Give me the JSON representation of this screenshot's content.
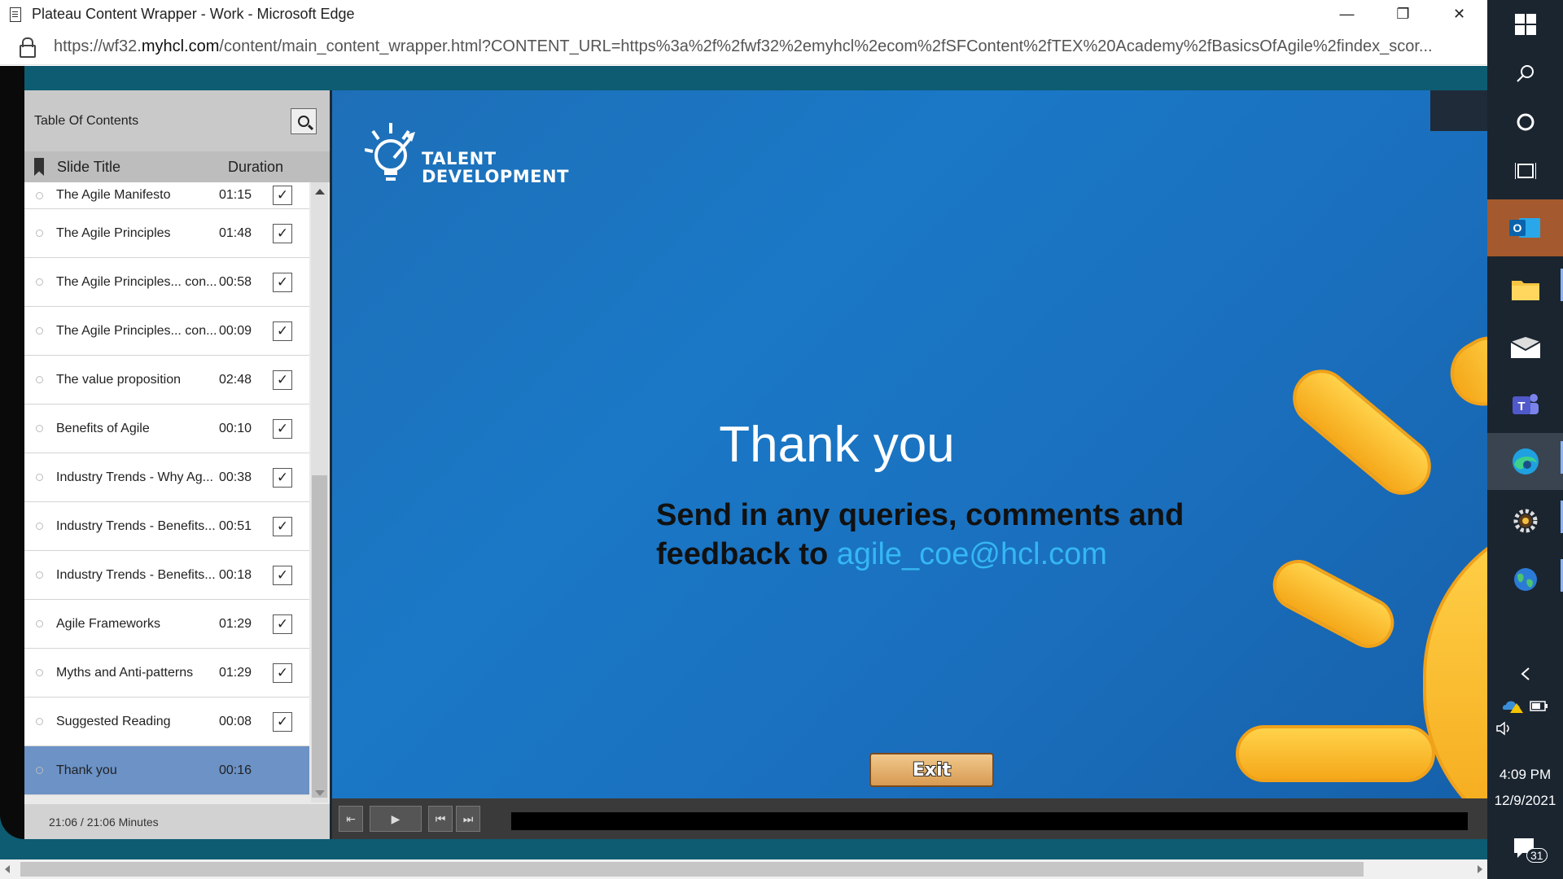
{
  "window": {
    "title": "Plateau Content Wrapper - Work - Microsoft Edge",
    "minimize": "—",
    "maximize": "❐",
    "close": "✕"
  },
  "address": {
    "url_domain_prefix": "https://wf32.",
    "url_domain": "myhcl.com",
    "url_rest": "/content/main_content_wrapper.html?CONTENT_URL=https%3a%2f%2fwf32%2emyhcl%2ecom%2fSFContent%2fTEX%20Academy%2fBasicsOfAgile%2findex_scor..."
  },
  "toc": {
    "title": "Table Of Contents",
    "col_title": "Slide Title",
    "col_duration": "Duration",
    "items": [
      {
        "title": "The Agile Manifesto",
        "duration": "01:15"
      },
      {
        "title": "The Agile Principles",
        "duration": "01:48"
      },
      {
        "title": "The Agile Principles... con...",
        "duration": "00:58"
      },
      {
        "title": "The Agile Principles... con...",
        "duration": "00:09"
      },
      {
        "title": "The value proposition",
        "duration": "02:48"
      },
      {
        "title": "Benefits of Agile",
        "duration": "00:10"
      },
      {
        "title": "Industry Trends - Why Ag...",
        "duration": "00:38"
      },
      {
        "title": "Industry Trends - Benefits...",
        "duration": "00:51"
      },
      {
        "title": "Industry Trends - Benefits...",
        "duration": "00:18"
      },
      {
        "title": "Agile Frameworks",
        "duration": "01:29"
      },
      {
        "title": "Myths and Anti-patterns",
        "duration": "01:29"
      },
      {
        "title": "Suggested Reading",
        "duration": "00:08"
      },
      {
        "title": "Thank you",
        "duration": "00:16"
      }
    ],
    "check_glyph": "✓",
    "footer": "21:06 / 21:06 Minutes"
  },
  "slide": {
    "logo_line1": "TALENT",
    "logo_line2": "DEVELOPMENT",
    "heading": "Thank you",
    "message": "Send in any queries, comments and feedback to",
    "message_line1": "Send in any queries, comments and",
    "message_line2": "feedback to",
    "email": "agile_coe@hcl.com",
    "exit_label": "Exit"
  },
  "controls": {
    "exit_icon": "⇤",
    "play_icon": "▶",
    "prev_icon": "⏮",
    "next_icon": "⏭"
  },
  "taskbar": {
    "time": "4:09 PM",
    "date": "12/9/2021",
    "notification_count": "31"
  },
  "colors": {
    "active_row": "#6c92c6",
    "slide_blue": "#1a78c6",
    "email_link": "#35b7f3",
    "outlook_active": "#a45a2e"
  }
}
